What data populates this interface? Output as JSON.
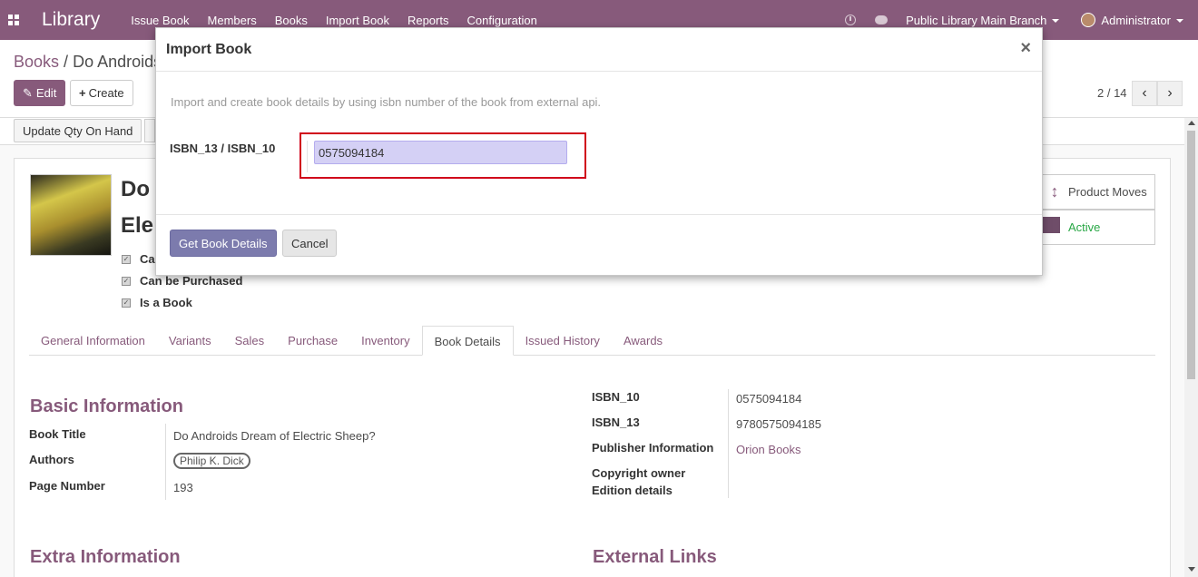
{
  "navbar": {
    "brand": "Library",
    "menu": [
      "Issue Book",
      "Members",
      "Books",
      "Import Book",
      "Reports",
      "Configuration"
    ],
    "branch": "Public Library Main Branch",
    "user": "Administrator",
    "icons": [
      "apps-grid-icon",
      "clock-icon",
      "chat-icon"
    ]
  },
  "control": {
    "breadcrumb_parent": "Books",
    "breadcrumb_sep": "/",
    "breadcrumb_current": "Do Androids",
    "edit_label": "Edit",
    "create_label": "Create",
    "pager": "2 / 14"
  },
  "status": {
    "update_qty_label": "Update Qty On Hand"
  },
  "record": {
    "name_line1": "Do",
    "name_line2": "Ele",
    "checkbox_first_label": "Ca",
    "checkbox_purchased_label": "Can be Purchased",
    "checkbox_book_label": "Is a Book",
    "smart_product_moves": "Product Moves",
    "smart_active": "Active"
  },
  "tabs": [
    "General Information",
    "Variants",
    "Sales",
    "Purchase",
    "Inventory",
    "Book Details",
    "Issued History",
    "Awards"
  ],
  "active_tab": "Book Details",
  "basic": {
    "title": "Basic Information",
    "book_title_label": "Book Title",
    "book_title_value": "Do Androids Dream of Electric Sheep?",
    "authors_label": "Authors",
    "author_tag": "Philip K. Dick",
    "page_number_label": "Page Number",
    "page_number_value": "193"
  },
  "right_fields": {
    "isbn10_label": "ISBN_10",
    "isbn10_value": "0575094184",
    "isbn13_label": "ISBN_13",
    "isbn13_value": "9780575094185",
    "publisher_label": "Publisher Information",
    "publisher_value": "Orion Books",
    "copyright_label": "Copyright owner",
    "edition_label": "Edition details"
  },
  "extra": {
    "title": "Extra Information",
    "external_title": "External Links"
  },
  "modal": {
    "title": "Import Book",
    "close": "×",
    "description": "Import and create book details by using isbn number of the book from external api.",
    "isbn_label": "ISBN_13 / ISBN_10",
    "isbn_value": "0575094184",
    "primary_label": "Get Book Details",
    "cancel_label": "Cancel"
  },
  "colors": {
    "brand": "#875a7b",
    "primary_button": "#7c7bad",
    "highlight_box": "#d0021b",
    "input_bg": "#d4d0f5"
  }
}
